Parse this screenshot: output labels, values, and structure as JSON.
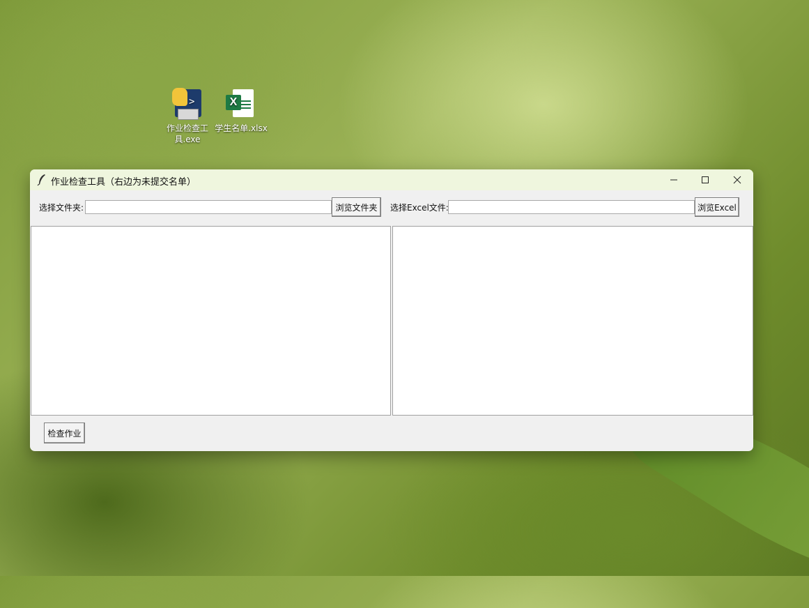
{
  "desktop": {
    "icons": [
      {
        "label_line1": "作业检查工",
        "label_line2": "具.exe",
        "icon": "python-exe-icon"
      },
      {
        "label_line1": "学生名单.xlsx",
        "icon": "excel-file-icon"
      }
    ]
  },
  "window": {
    "title": "作业检查工具（右边为未提交名单）",
    "icon": "feather-icon",
    "controls": {
      "minimize": "minimize-icon",
      "maximize": "maximize-icon",
      "close": "close-icon"
    },
    "folder": {
      "label": "选择文件夹:",
      "value": "",
      "browse_label": "浏览文件夹"
    },
    "excel": {
      "label": "选择Excel文件:",
      "value": "",
      "browse_label": "浏览Excel"
    },
    "left_text": "",
    "right_text": "",
    "check_label": "检查作业",
    "colors": {
      "titlebar": "#eff6de",
      "body": "#f0f0f0"
    }
  }
}
